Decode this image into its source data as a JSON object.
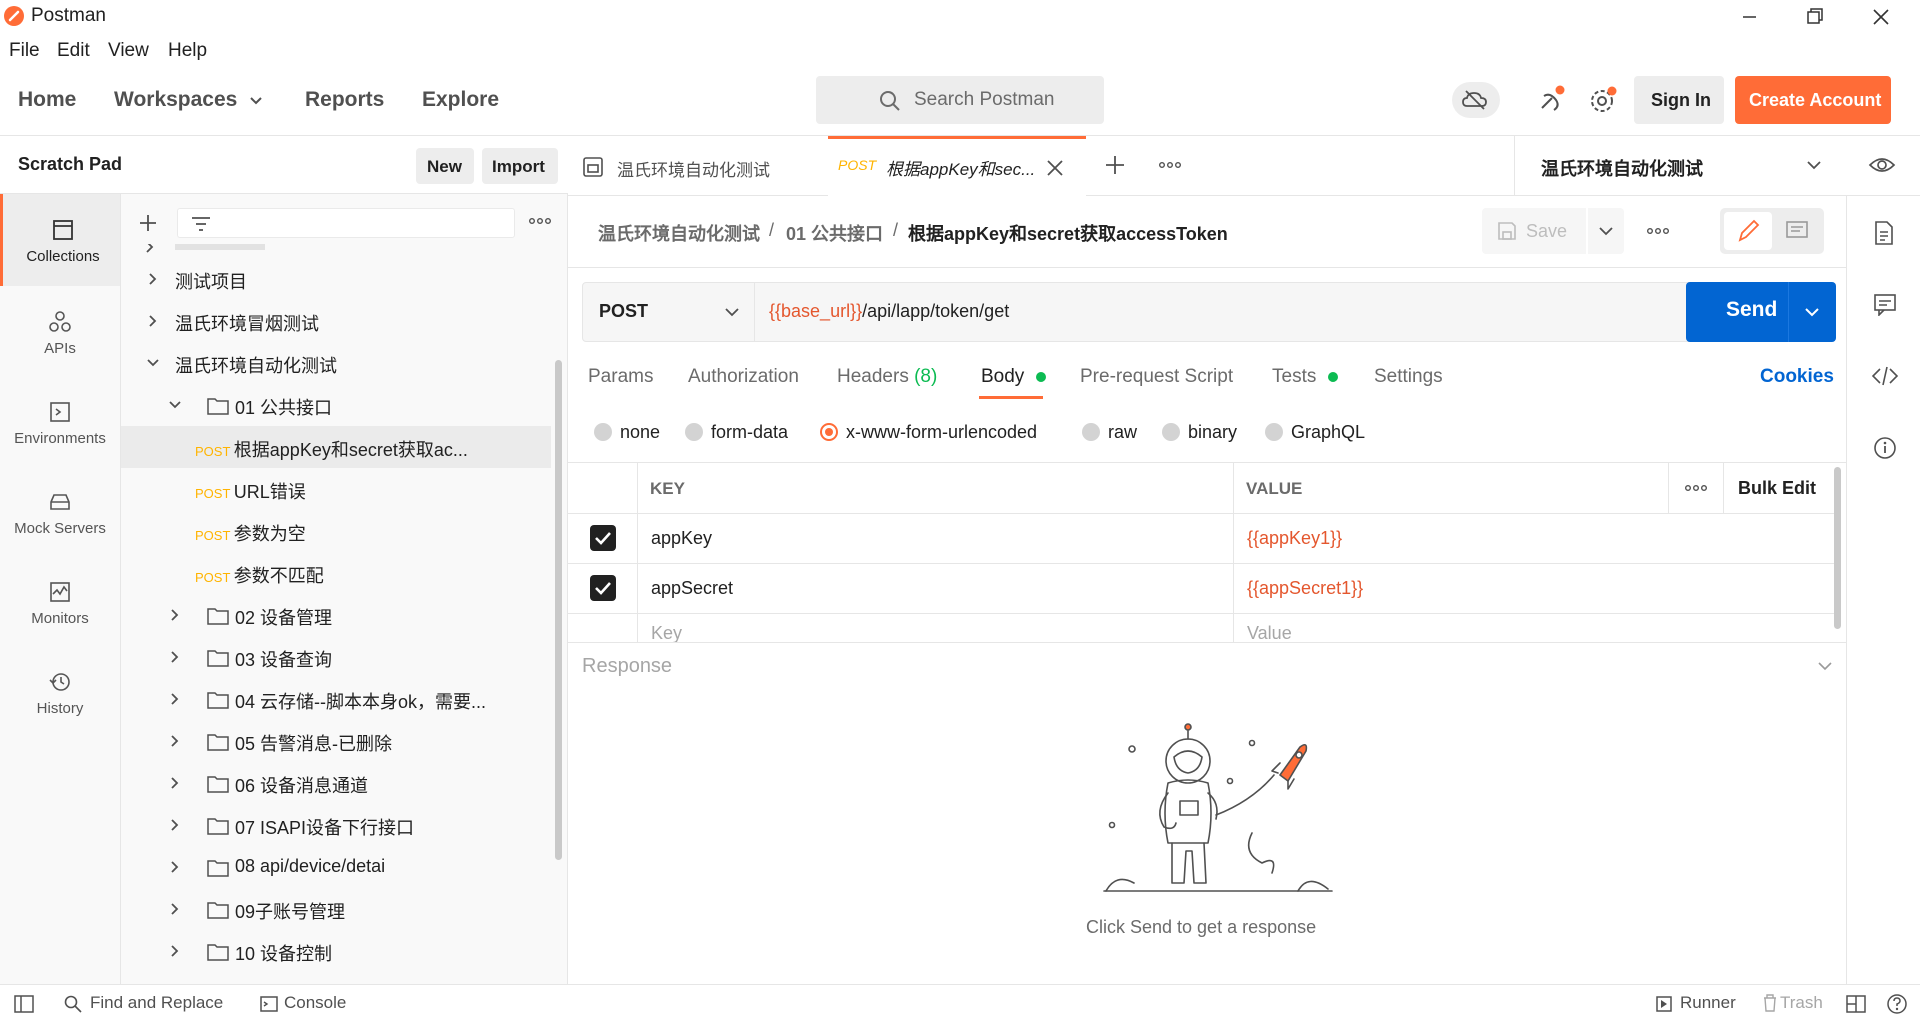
{
  "window": {
    "title": "Postman"
  },
  "menu": [
    "File",
    "Edit",
    "View",
    "Help"
  ],
  "header": {
    "nav": [
      "Home",
      "Workspaces",
      "Reports",
      "Explore"
    ],
    "search_placeholder": "Search Postman",
    "sign_in": "Sign In",
    "create_account": "Create Account"
  },
  "sidebar": {
    "title": "Scratch Pad",
    "new": "New",
    "import": "Import",
    "rail": [
      "Collections",
      "APIs",
      "Environments",
      "Mock Servers",
      "Monitors",
      "History"
    ],
    "tree": [
      {
        "label": "测试项目",
        "level": 0,
        "type": "collection",
        "chevron": "right"
      },
      {
        "label": "温氏环境冒烟测试",
        "level": 0,
        "type": "collection",
        "chevron": "right"
      },
      {
        "label": "温氏环境自动化测试",
        "level": 0,
        "type": "collection",
        "chevron": "down"
      },
      {
        "label": "01 公共接口",
        "level": 1,
        "type": "folder",
        "chevron": "down"
      },
      {
        "label": "根据appKey和secret获取ac...",
        "level": 2,
        "type": "request",
        "method": "POST",
        "selected": true
      },
      {
        "label": "URL错误",
        "level": 2,
        "type": "request",
        "method": "POST"
      },
      {
        "label": "参数为空",
        "level": 2,
        "type": "request",
        "method": "POST"
      },
      {
        "label": "参数不匹配",
        "level": 2,
        "type": "request",
        "method": "POST"
      },
      {
        "label": "02 设备管理",
        "level": 1,
        "type": "folder",
        "chevron": "right"
      },
      {
        "label": "03 设备查询",
        "level": 1,
        "type": "folder",
        "chevron": "right"
      },
      {
        "label": "04 云存储--脚本本身ok，需要...",
        "level": 1,
        "type": "folder",
        "chevron": "right"
      },
      {
        "label": "05 告警消息-已删除",
        "level": 1,
        "type": "folder",
        "chevron": "right"
      },
      {
        "label": "06 设备消息通道",
        "level": 1,
        "type": "folder",
        "chevron": "right"
      },
      {
        "label": "07 ISAPI设备下行接口",
        "level": 1,
        "type": "folder",
        "chevron": "right"
      },
      {
        "label": "08 api/device/detai",
        "level": 1,
        "type": "folder",
        "chevron": "right"
      },
      {
        "label": "09子账号管理",
        "level": 1,
        "type": "folder",
        "chevron": "right"
      },
      {
        "label": "10 设备控制",
        "level": 1,
        "type": "folder",
        "chevron": "right"
      }
    ]
  },
  "tabs": {
    "items": [
      {
        "label": "温氏环境自动化测试",
        "active": false
      },
      {
        "method": "POST",
        "label": "根据appKey和sec...",
        "active": true
      }
    ],
    "environment": "温氏环境自动化测试"
  },
  "request": {
    "breadcrumb": [
      "温氏环境自动化测试",
      "01 公共接口",
      "根据appKey和secret获取accessToken"
    ],
    "save": "Save",
    "method": "POST",
    "url_var": "{{base_url}}",
    "url_path": "/api/lapp/token/get",
    "send": "Send",
    "tabs": [
      "Params",
      "Authorization",
      "Headers",
      "Body",
      "Pre-request Script",
      "Tests",
      "Settings"
    ],
    "headers_count": "(8)",
    "cookies": "Cookies",
    "body_types": [
      "none",
      "form-data",
      "x-www-form-urlencoded",
      "raw",
      "binary",
      "GraphQL"
    ],
    "selected_body_type": "x-www-form-urlencoded",
    "table": {
      "key_header": "KEY",
      "value_header": "VALUE",
      "bulk_edit": "Bulk Edit",
      "rows": [
        {
          "key": "appKey",
          "value": "{{appKey1}}",
          "checked": true
        },
        {
          "key": "appSecret",
          "value": "{{appSecret1}}",
          "checked": true
        }
      ],
      "key_placeholder": "Key",
      "value_placeholder": "Value"
    }
  },
  "response": {
    "title": "Response",
    "empty_message": "Click Send to get a response"
  },
  "statusbar": {
    "find_replace": "Find and Replace",
    "console": "Console",
    "runner": "Runner",
    "trash": "Trash"
  },
  "colors": {
    "brand": "#ff6c37",
    "send": "#0265d2",
    "variable": "#e4572e",
    "post": "#ffb400",
    "green_dot": "#0cbb52"
  }
}
